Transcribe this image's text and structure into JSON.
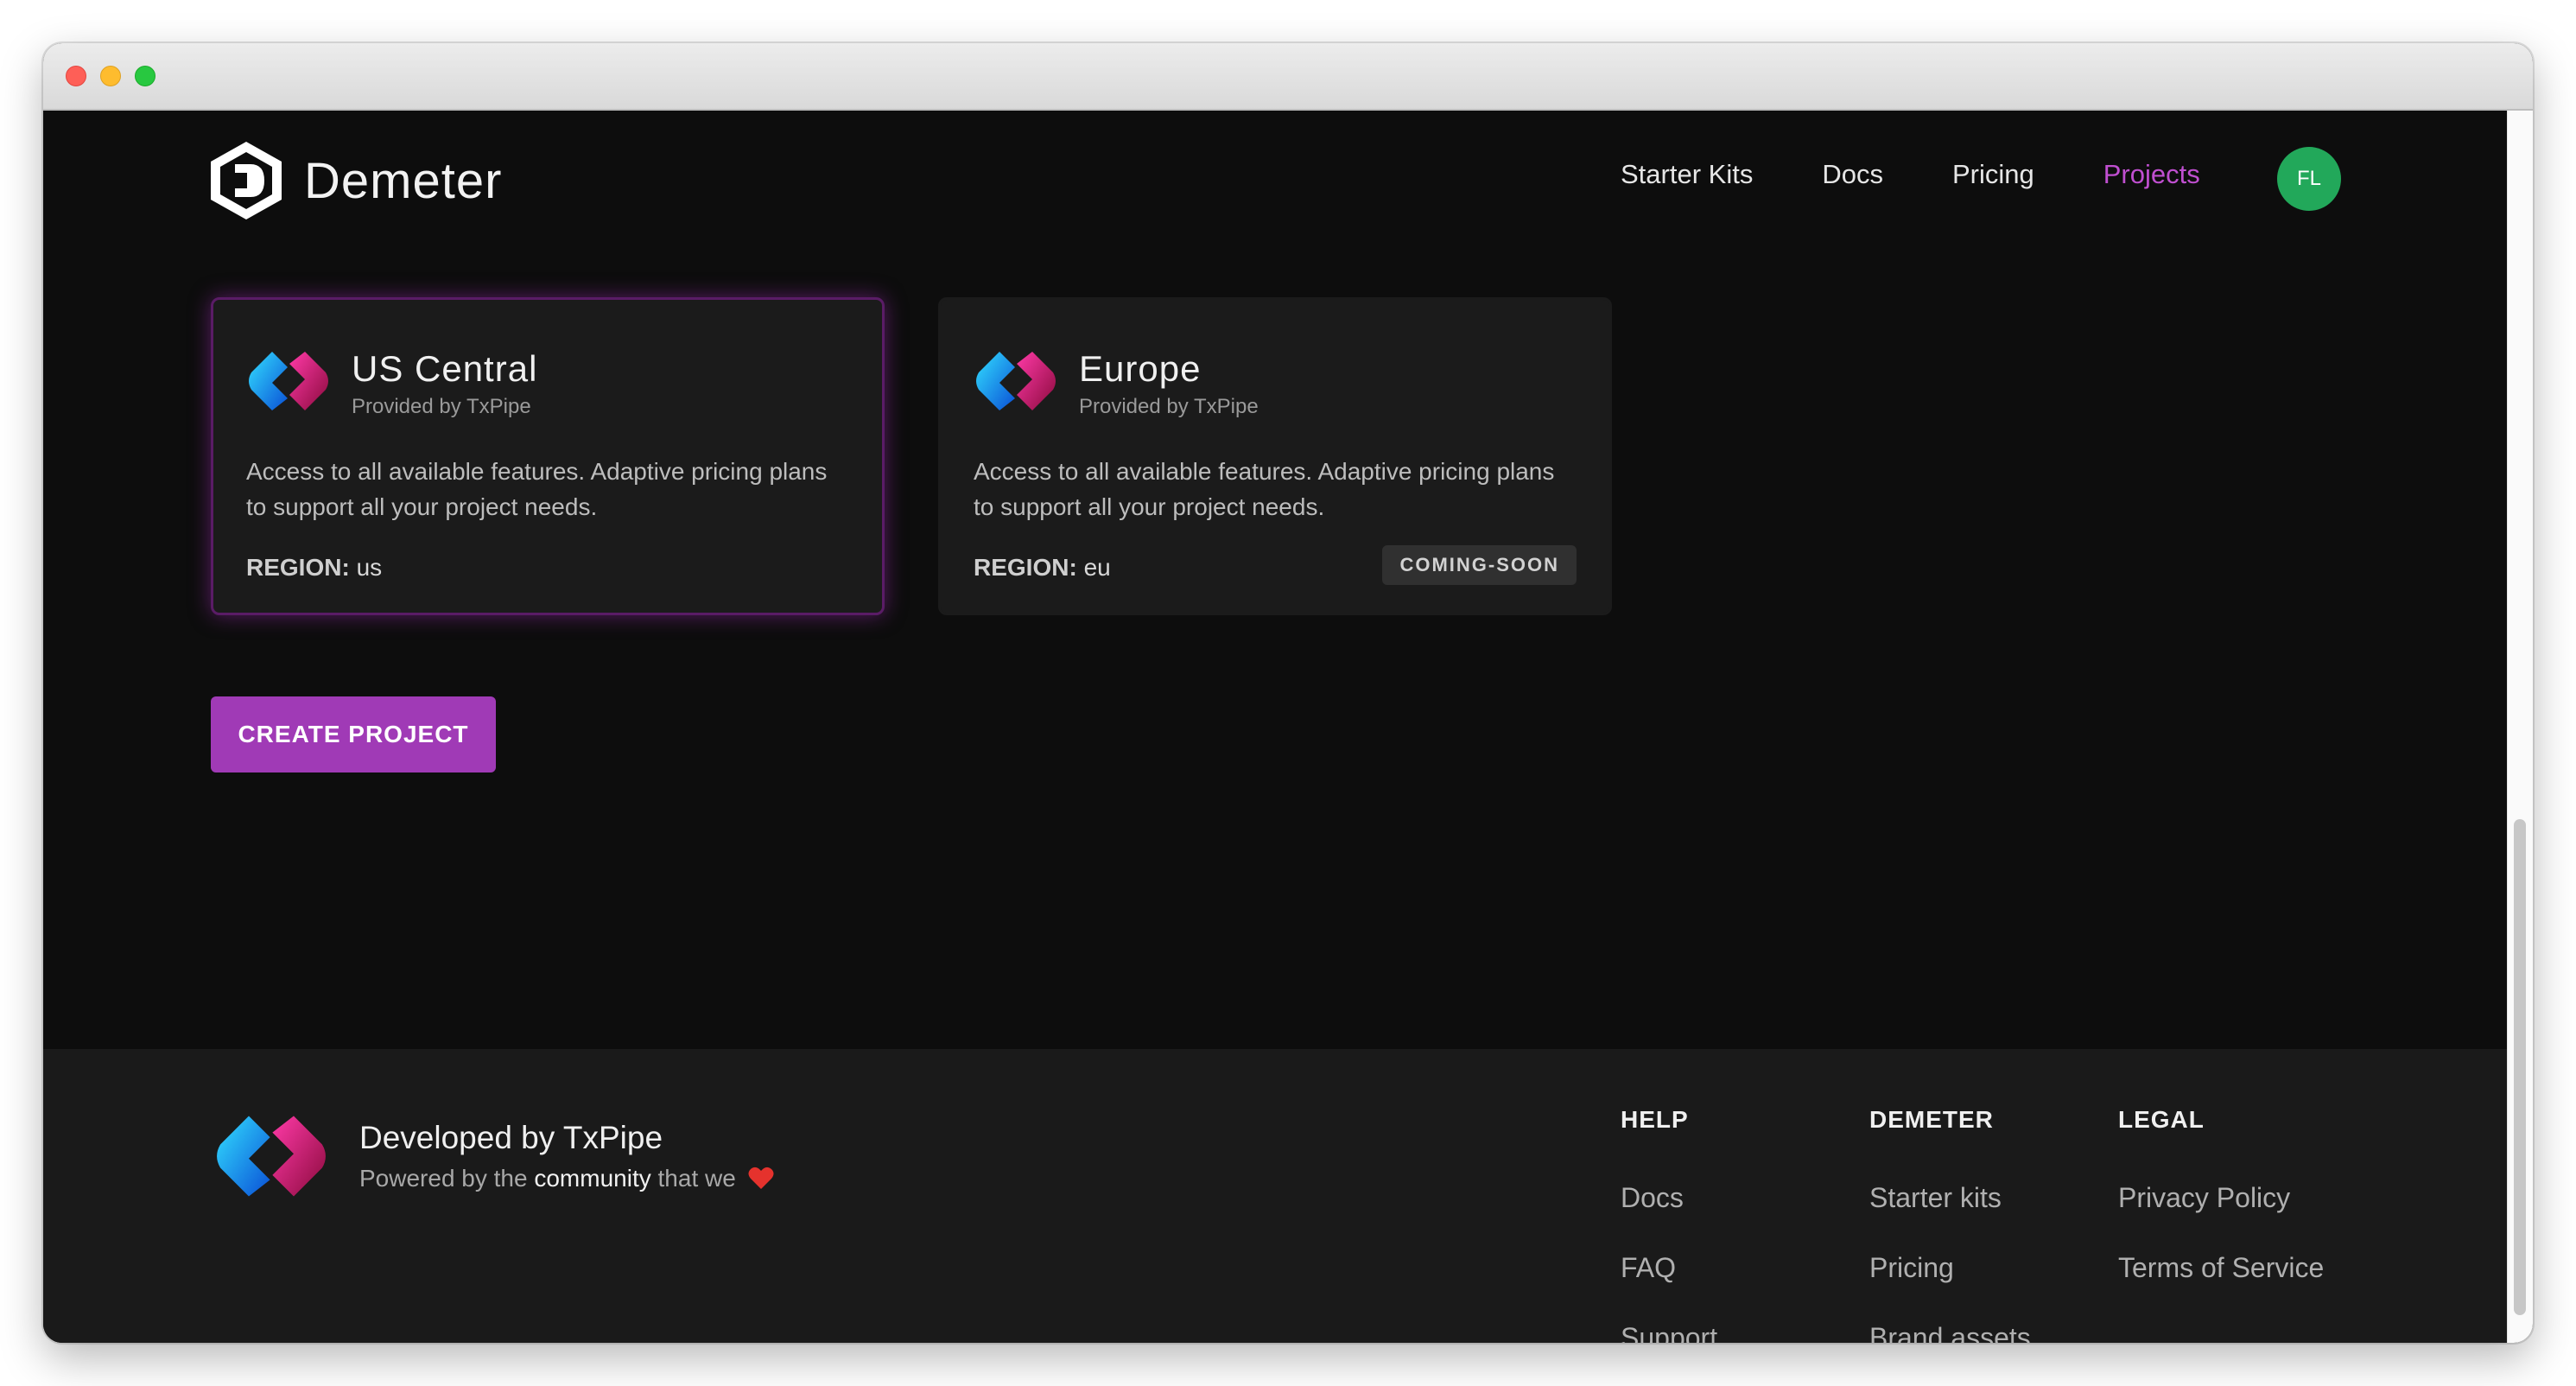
{
  "header": {
    "brand": "Demeter",
    "nav": [
      {
        "label": "Starter Kits",
        "active": false
      },
      {
        "label": "Docs",
        "active": false
      },
      {
        "label": "Pricing",
        "active": false
      },
      {
        "label": "Projects",
        "active": true
      }
    ],
    "avatar_initials": "FL",
    "accent_color": "#c04fd0",
    "avatar_color": "#22a85a"
  },
  "regions": [
    {
      "title": "US Central",
      "provider": "Provided by TxPipe",
      "description": "Access to all available features. Adaptive pricing plans to support all your project needs.",
      "region_label": "REGION:",
      "region_value": "us",
      "selected": true
    },
    {
      "title": "Europe",
      "provider": "Provided by TxPipe",
      "description": "Access to all available features. Adaptive pricing plans to support all your project needs.",
      "region_label": "REGION:",
      "region_value": "eu",
      "badge": "COMING-SOON",
      "selected": false
    }
  ],
  "create_button": "CREATE PROJECT",
  "footer": {
    "title": "Developed by TxPipe",
    "subtitle_prefix": "Powered by the",
    "subtitle_strong": "community",
    "subtitle_suffix": "that we",
    "columns": [
      {
        "heading": "HELP",
        "links": [
          "Docs",
          "FAQ",
          "Support"
        ]
      },
      {
        "heading": "DEMETER",
        "links": [
          "Starter kits",
          "Pricing",
          "Brand assets"
        ]
      },
      {
        "heading": "LEGAL",
        "links": [
          "Privacy Policy",
          "Terms of Service"
        ]
      }
    ]
  },
  "icons": {
    "brand_logo": "demeter-logo-icon",
    "provider_logo": "txpipe-logo-icon",
    "heart": "heart-icon"
  }
}
